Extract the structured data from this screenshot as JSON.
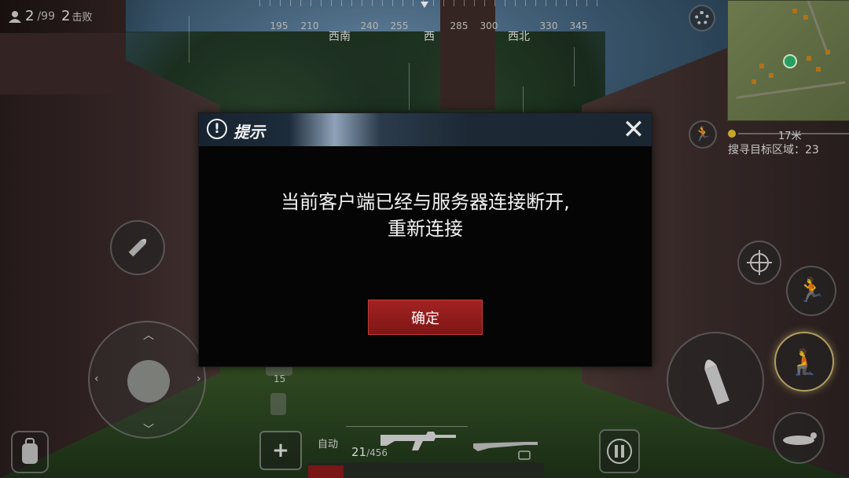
{
  "hud": {
    "alive_count": "2",
    "alive_total": "/99",
    "kills_count": "2",
    "kills_label": "击败"
  },
  "compass": {
    "labels": [
      "195",
      "210",
      "西南",
      "240",
      "255",
      "西",
      "285",
      "300",
      "西北",
      "330",
      "345"
    ]
  },
  "minimap": {
    "distance": "17米",
    "search_zone_label": "搜寻目标区域：23"
  },
  "inventory": {
    "item_count": "15"
  },
  "weapon": {
    "fire_mode": "自动",
    "ammo_loaded": "21",
    "ammo_reserve": "/456",
    "health_fraction": 0.15
  },
  "dialog": {
    "title": "提示",
    "close": "✕",
    "warn_symbol": "!",
    "message_line1": "当前客户端已经与服务器连接断开,",
    "message_line2": "重新连接",
    "confirm_label": "确定"
  },
  "colors": {
    "confirm_button": "#9b1e1e",
    "dialog_background": "#050505",
    "player_marker": "#2fb36a"
  }
}
